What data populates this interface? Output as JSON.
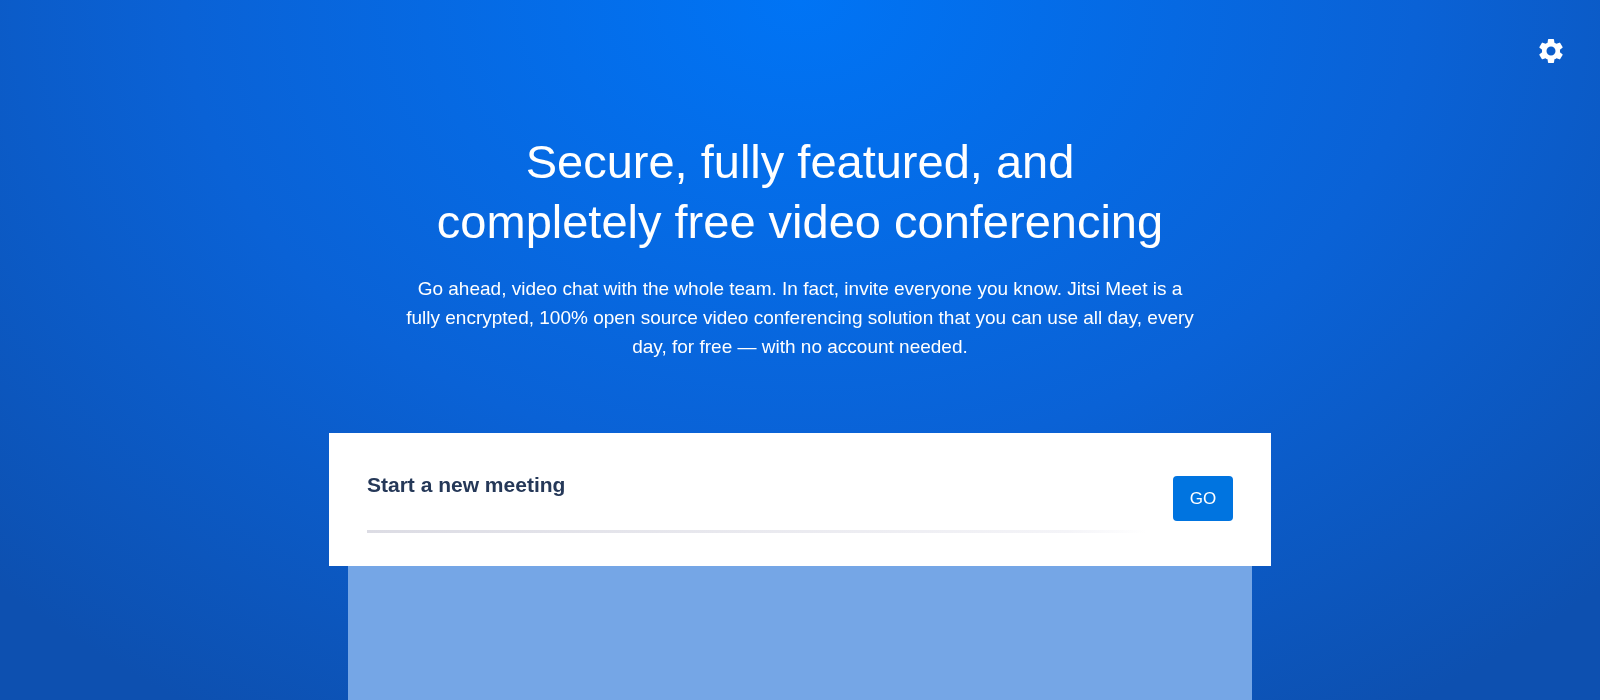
{
  "header": {
    "title_lines": [
      "Secure, fully featured, and",
      "completely free video conferencing"
    ],
    "description": "Go ahead, video chat with the whole team. In fact, invite everyone you know. Jitsi Meet is a fully encrypted, 100% open source video conferencing solution that you can use all day, every day, for free — with no account needed."
  },
  "meeting_form": {
    "placeholder": "Start a new meeting",
    "button": "GO"
  }
}
